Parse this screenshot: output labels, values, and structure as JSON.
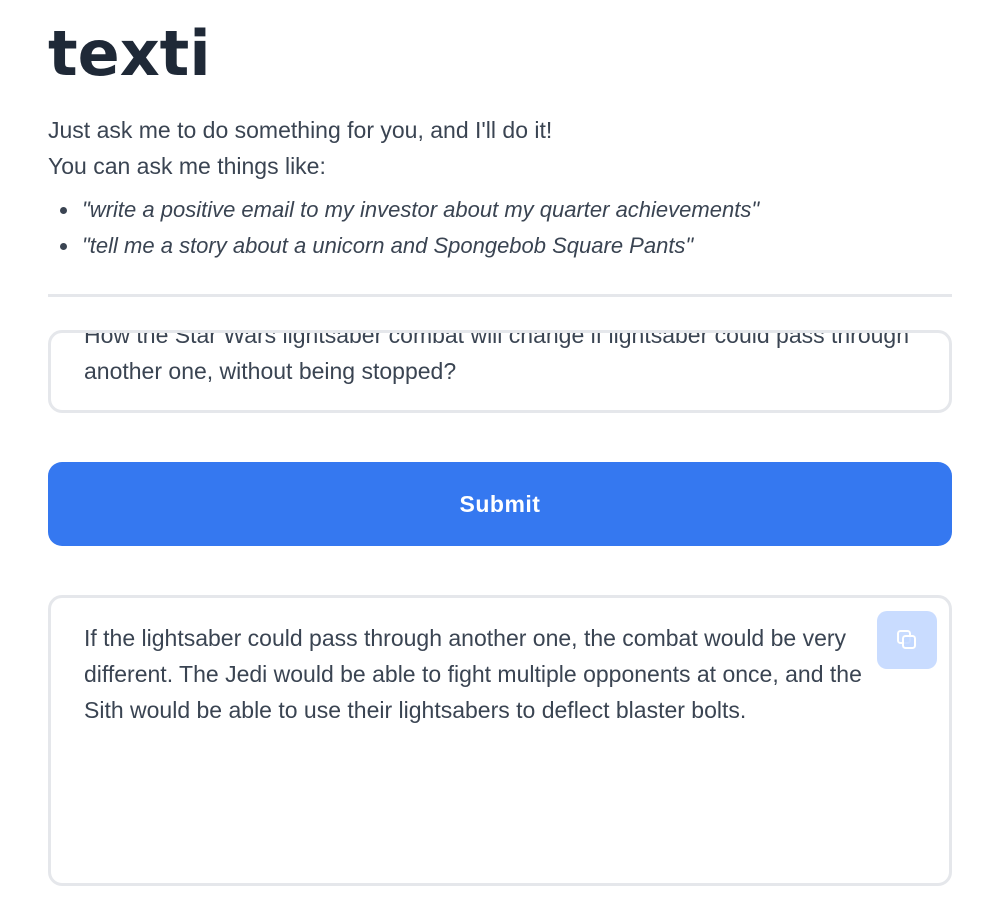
{
  "app": {
    "logo": "texti"
  },
  "intro": {
    "line1": "Just ask me to do something for you, and I'll do it!",
    "line2": "You can ask me things like:",
    "examples": [
      "\"write a positive email to my investor about my quarter achievements\"",
      "\"tell me a story about a unicorn and Spongebob Square Pants\""
    ]
  },
  "prompt": {
    "value": "How the Star Wars lightsaber combat will change if lightsaber could pass through another one, without being stopped?"
  },
  "submit": {
    "label": "Submit"
  },
  "result": {
    "text": "If the lightsaber could pass through another one, the combat would be very different. The Jedi would be able to fight multiple opponents at once, and the Sith would be able to use their lightsabers to deflect blaster bolts.",
    "copy_icon": "copy-icon"
  },
  "colors": {
    "accent": "#3578f0",
    "border": "#e5e7eb",
    "text": "#3a4452",
    "logo": "#1f2937",
    "copy_bg": "#bfd6ff"
  }
}
